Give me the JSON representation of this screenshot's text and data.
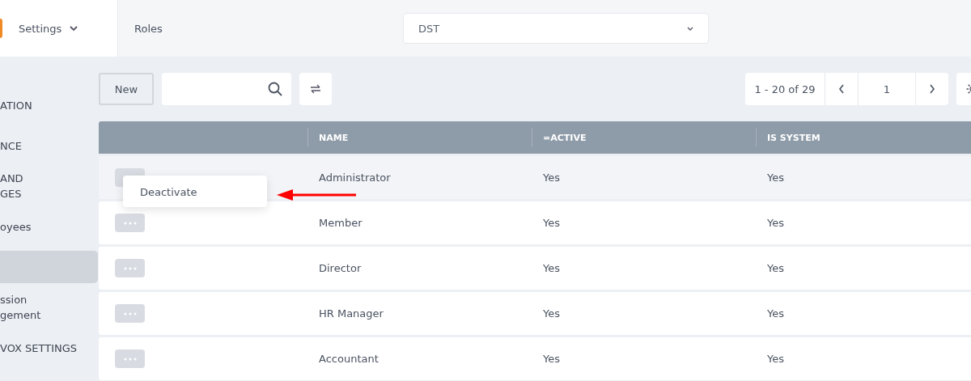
{
  "app_menu": {
    "label": "Settings"
  },
  "header": {
    "title": "Roles",
    "company_select": {
      "value": "DST"
    }
  },
  "sidebar": {
    "items": [
      {
        "lines": [
          "ATION"
        ],
        "selected": false
      },
      {
        "lines": [
          "NCE"
        ],
        "selected": false
      },
      {
        "lines": [
          "AND",
          "GES"
        ],
        "selected": false
      },
      {
        "lines": [
          "oyees"
        ],
        "selected": false
      },
      {
        "selected": true
      },
      {
        "lines": [
          "ssion",
          "gement"
        ],
        "selected": false
      },
      {
        "lines": [
          "VOX SETTINGS"
        ],
        "selected": false
      }
    ]
  },
  "toolbar": {
    "new_button": "New",
    "pagination": {
      "range": "1 - 20 of 29",
      "page": "1"
    }
  },
  "table": {
    "columns": [
      "NAME",
      "=ACTIVE",
      "IS SYSTEM"
    ],
    "rows": [
      {
        "cells": [
          "Administrator",
          "Yes",
          "Yes"
        ],
        "hovered": true
      },
      {
        "cells": [
          "Member",
          "Yes",
          "Yes"
        ],
        "hovered": false
      },
      {
        "cells": [
          "Director",
          "Yes",
          "Yes"
        ],
        "hovered": false
      },
      {
        "cells": [
          "HR Manager",
          "Yes",
          "Yes"
        ],
        "hovered": false
      },
      {
        "cells": [
          "Accountant",
          "Yes",
          "Yes"
        ],
        "hovered": false
      }
    ]
  },
  "row_menu": {
    "items": [
      "Deactivate"
    ]
  }
}
